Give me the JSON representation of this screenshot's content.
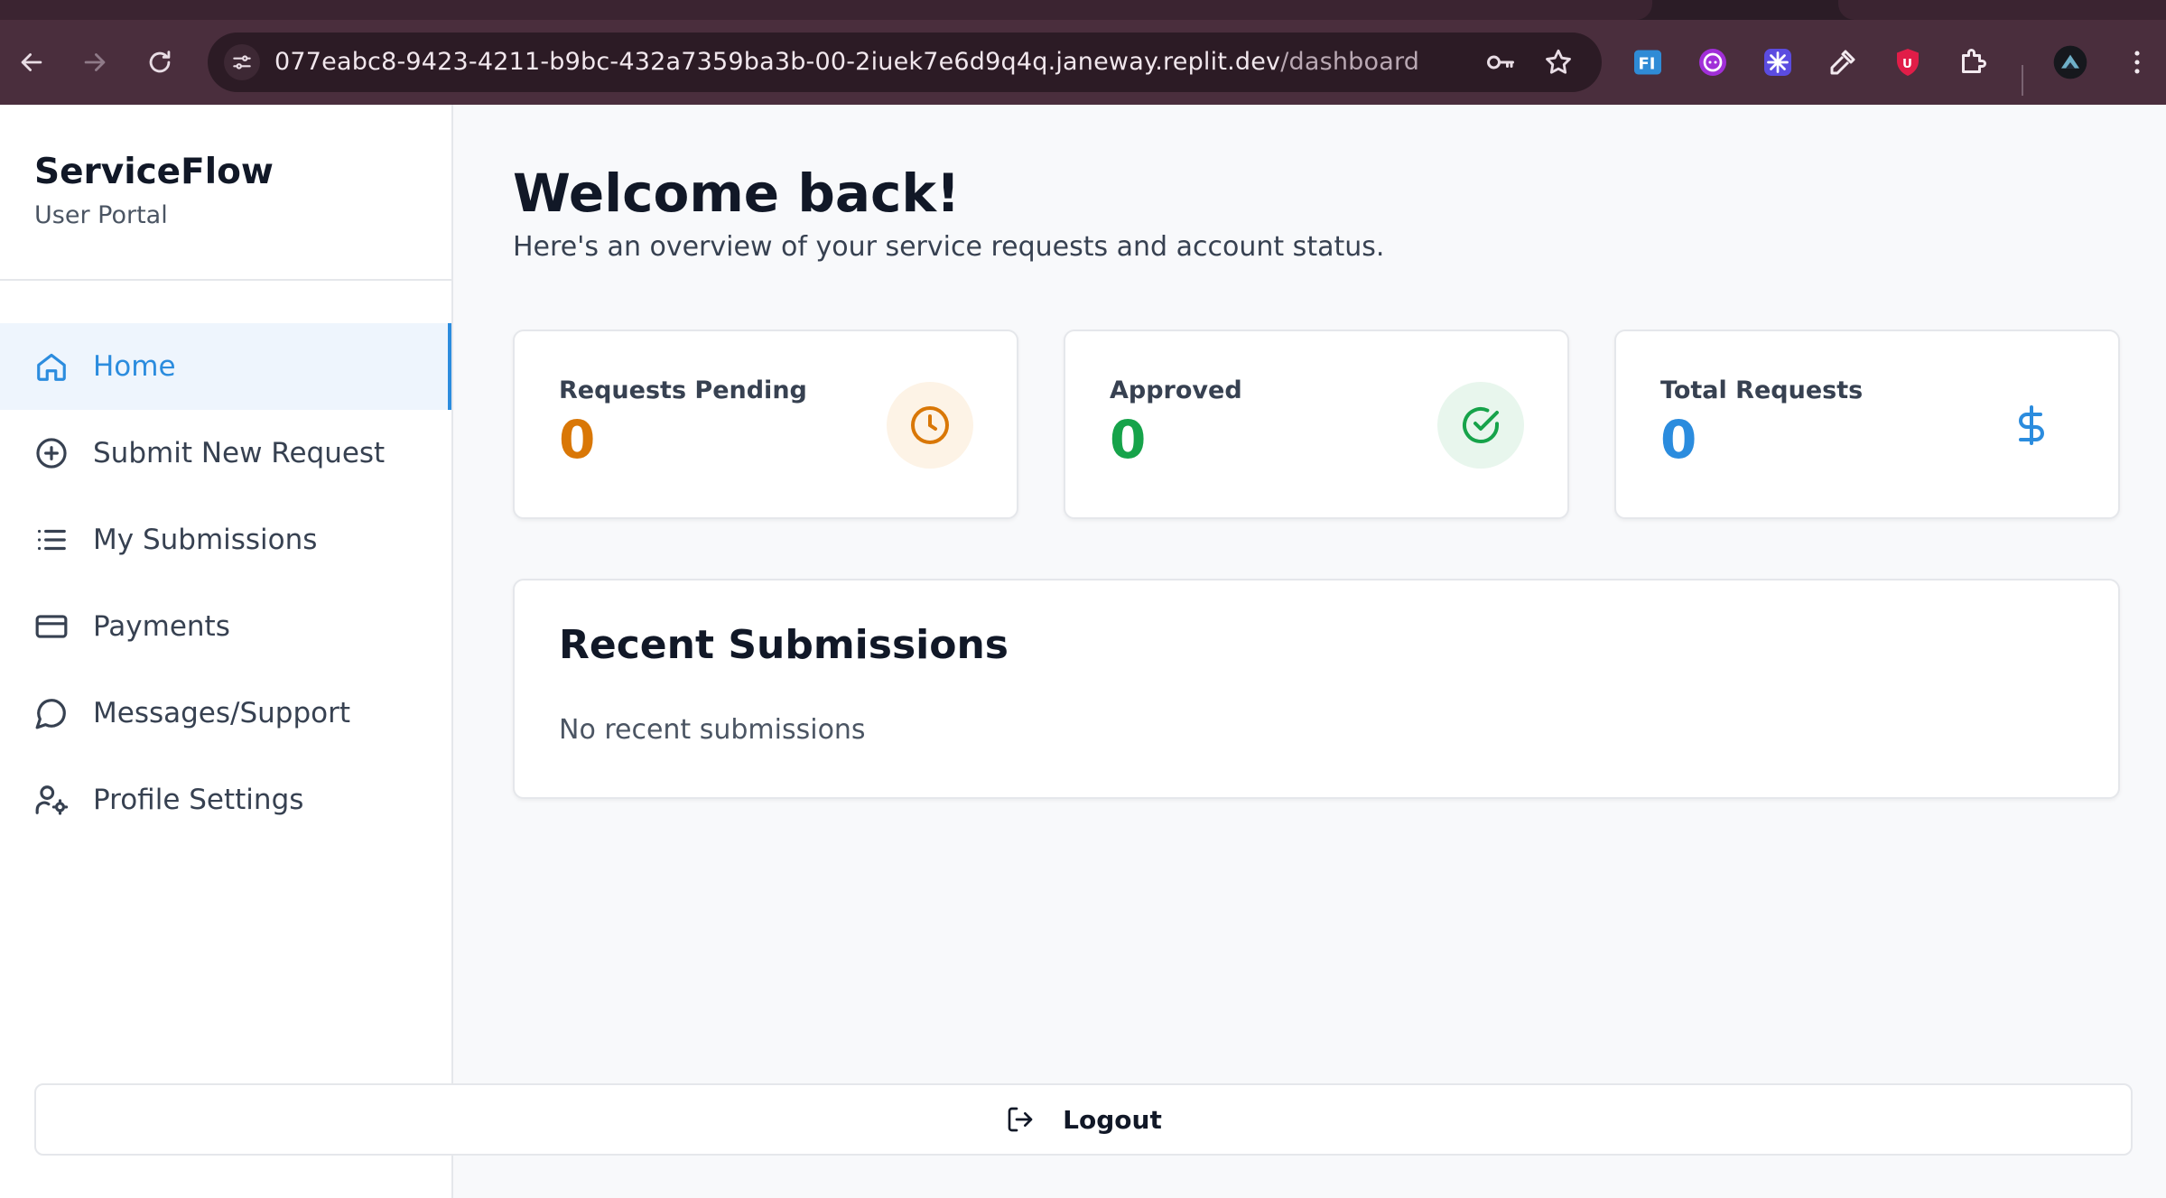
{
  "browser": {
    "url_host": "077eabc8-9423-4211-b9bc-432a7359ba3b-00-2iuek7e6d9q4q.janeway.replit.dev",
    "url_path": "/dashboard"
  },
  "brand": {
    "title": "ServiceFlow",
    "subtitle": "User Portal"
  },
  "nav": [
    {
      "label": "Home",
      "icon": "home-icon",
      "active": true
    },
    {
      "label": "Submit New Request",
      "icon": "plus-circle-icon"
    },
    {
      "label": "My Submissions",
      "icon": "list-icon"
    },
    {
      "label": "Payments",
      "icon": "credit-card-icon"
    },
    {
      "label": "Messages/Support",
      "icon": "message-icon"
    },
    {
      "label": "Profile Settings",
      "icon": "user-settings-icon"
    }
  ],
  "main": {
    "title": "Welcome back!",
    "subtitle": "Here's an overview of your service requests and account status."
  },
  "stats": [
    {
      "label": "Requests Pending",
      "value": "0",
      "color": "#d97706",
      "icon": "clock-icon"
    },
    {
      "label": "Approved",
      "value": "0",
      "color": "#16a34a",
      "icon": "check-circle-icon"
    },
    {
      "label": "Total Requests",
      "value": "0",
      "color": "#2b8cde",
      "icon": "dollar-icon"
    }
  ],
  "recent": {
    "title": "Recent Submissions",
    "empty": "No recent submissions"
  },
  "logout": {
    "label": "Logout"
  },
  "colors": {
    "accent": "#2b8cde",
    "chrome": "#4a2e3d"
  }
}
